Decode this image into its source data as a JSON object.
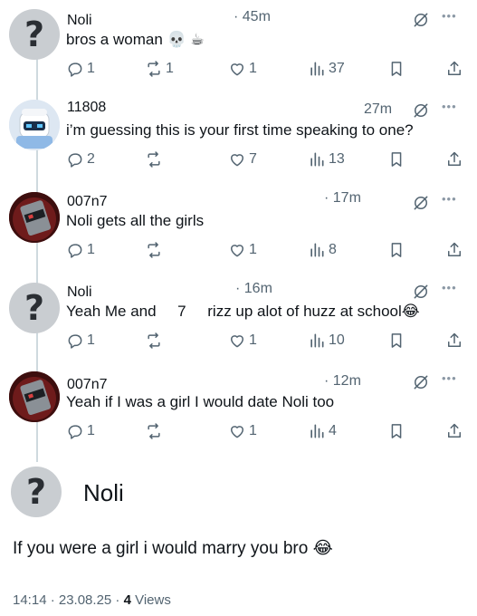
{
  "replies": [
    {
      "author": "Noli",
      "time": "· 45m",
      "text": "bros a woman 💀 ☕",
      "stats": {
        "replies": "1",
        "reposts": "1",
        "likes": "1",
        "views": "37"
      }
    },
    {
      "author": "11808",
      "time": "27m",
      "text": "i’m guessing this is your first time speaking to one?",
      "stats": {
        "replies": "2",
        "reposts": "",
        "likes": "7",
        "views": "13"
      }
    },
    {
      "author": "007n7",
      "time": "· 17m",
      "text": "Noli  gets all the girls",
      "stats": {
        "replies": "1",
        "reposts": "",
        "likes": "1",
        "views": "8"
      }
    },
    {
      "author": "Noli",
      "time": "· 16m",
      "text": "Yeah Me and     7     rizz up alot of huzz at school😂",
      "stats": {
        "replies": "1",
        "reposts": "",
        "likes": "1",
        "views": "10"
      }
    },
    {
      "author": "007n7",
      "time": "· 12m",
      "text": "Yeah if I was a girl I would date Noli  too",
      "stats": {
        "replies": "1",
        "reposts": "",
        "likes": "1",
        "views": "4"
      }
    }
  ],
  "main_post": {
    "author": "Noli",
    "text": "If you were a girl i would marry you bro 😂",
    "timestamp": "14:14 · 23.08.25 · ",
    "views_count": "4",
    "views_label": " Views"
  },
  "icons": {
    "reply": "reply-icon",
    "repost": "repost-icon",
    "like": "heart-icon",
    "views": "views-icon",
    "bookmark": "bookmark-icon",
    "share": "share-icon",
    "grok": "grok-icon",
    "more": "more-icon"
  },
  "colors": {
    "text": "#0f1419",
    "muted": "#536471",
    "thread_line": "#cfd9de"
  }
}
